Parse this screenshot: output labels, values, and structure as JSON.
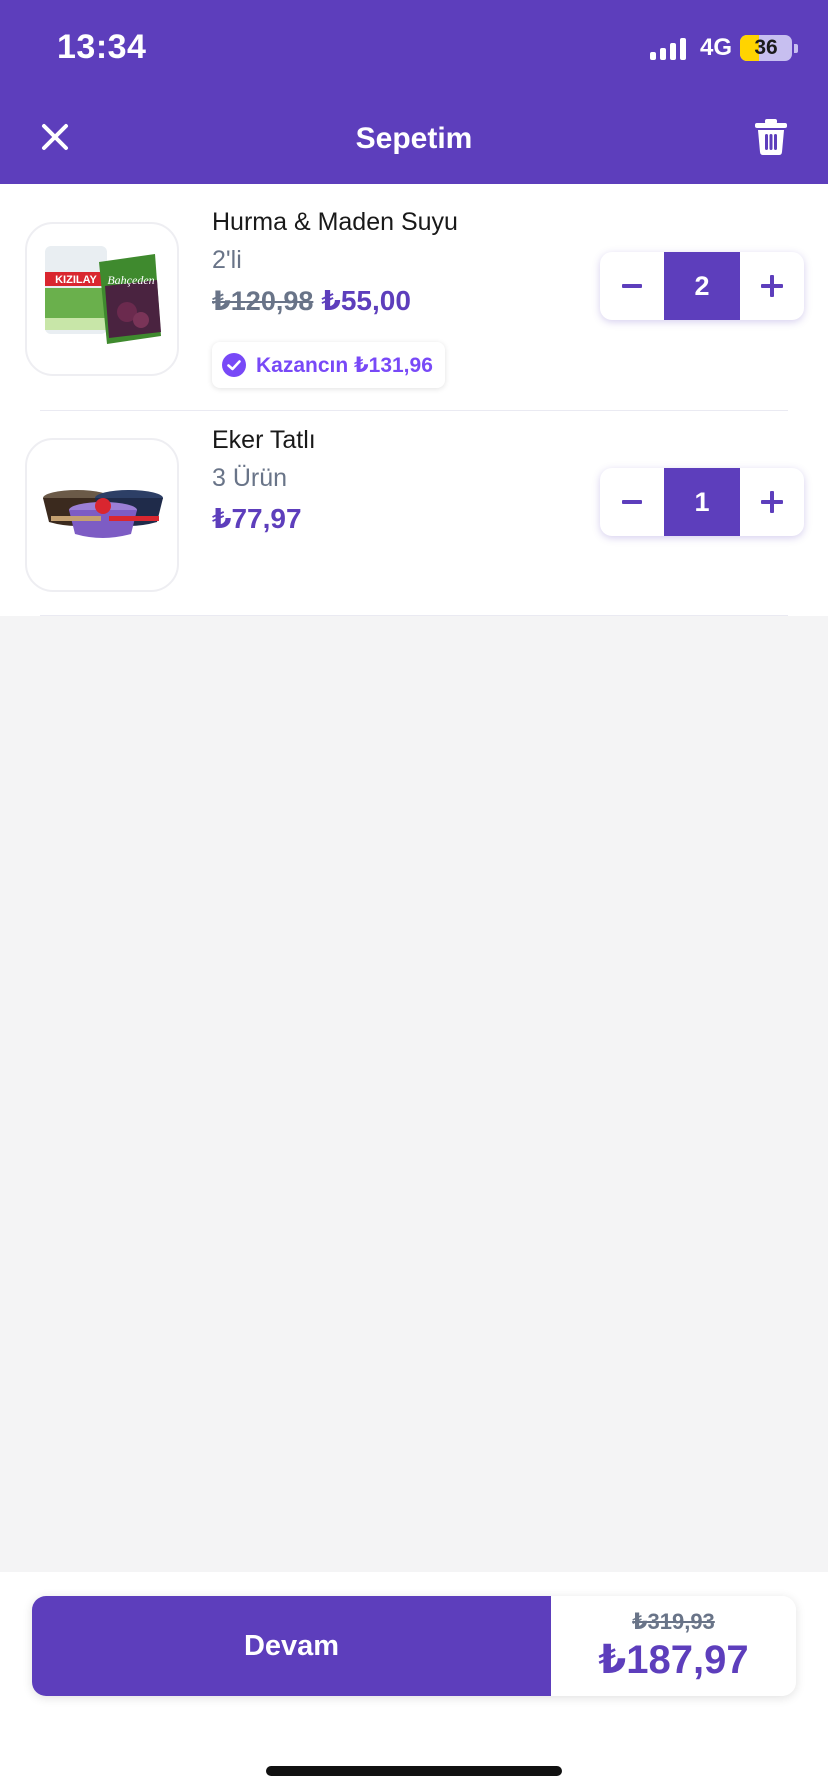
{
  "status_bar": {
    "time": "13:34",
    "network": "4G",
    "battery": "36",
    "battery_level": 0.36
  },
  "header": {
    "title": "Sepetim",
    "close_icon": "close-icon",
    "trash_icon": "trash-icon"
  },
  "cart": {
    "items": [
      {
        "name": "Hurma & Maden Suyu",
        "subtitle": "2'li",
        "old_price": "₺120,98",
        "price": "₺55,00",
        "savings": "Kazancın ₺131,96",
        "quantity": "2",
        "image": "product-image-kizilay-dates"
      },
      {
        "name": "Eker Tatlı",
        "subtitle": "3 Ürün",
        "price": "₺77,97",
        "quantity": "1",
        "image": "product-image-eker-desserts"
      }
    ]
  },
  "checkout": {
    "continue_label": "Devam",
    "old_total": "₺319,93",
    "total": "₺187,97"
  },
  "colors": {
    "brand": "#5d3ebc",
    "accent": "#7849f7",
    "muted": "#697488",
    "background": "#f4f4f5"
  }
}
